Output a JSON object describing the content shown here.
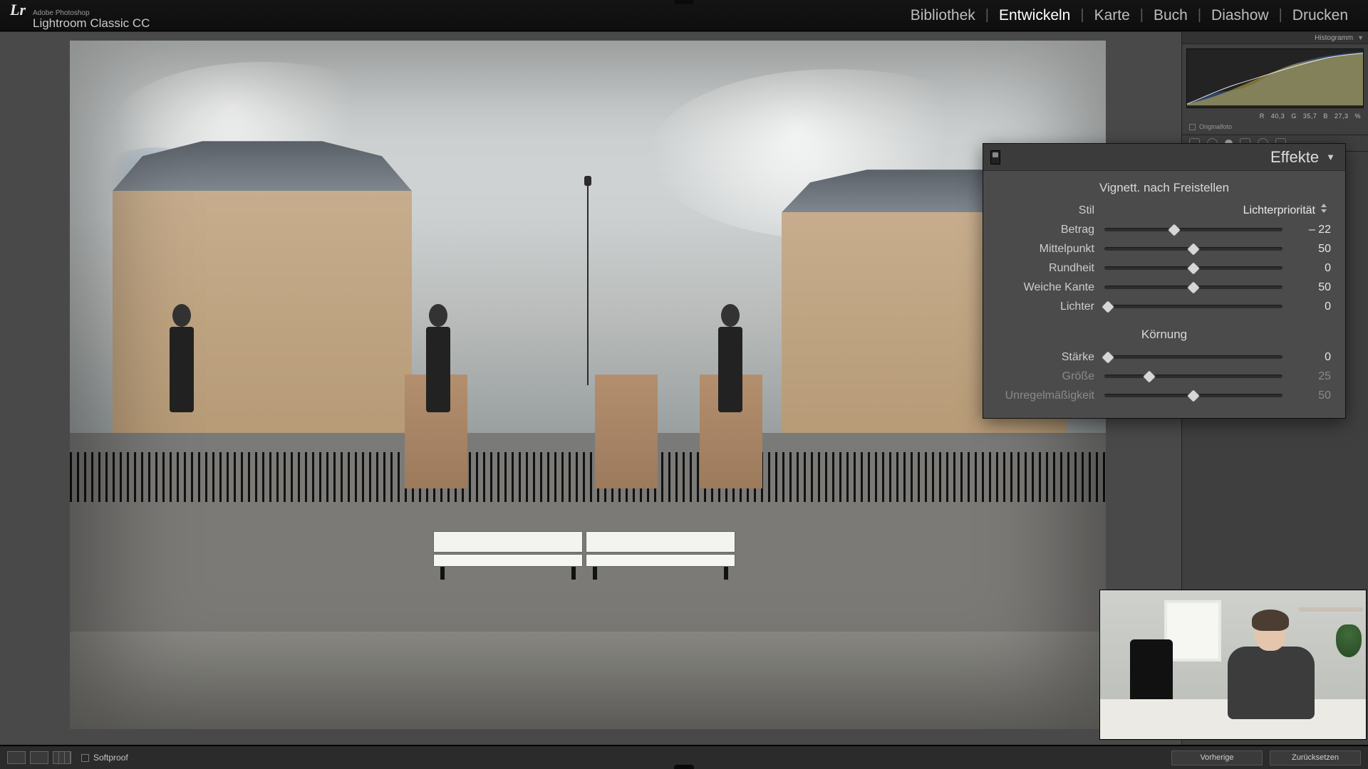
{
  "brand": {
    "sub": "Adobe Photoshop",
    "name": "Lightroom Classic CC",
    "logo": "Lr"
  },
  "modules": {
    "items": [
      "Bibliothek",
      "Entwickeln",
      "Karte",
      "Buch",
      "Diashow",
      "Drucken"
    ],
    "active_index": 1
  },
  "histogram": {
    "title": "Histogramm",
    "readout": {
      "r_label": "R",
      "r": "40,3",
      "g_label": "G",
      "g": "35,7",
      "b_label": "B",
      "b": "27,3",
      "pct": "%"
    },
    "original_checkbox": "Originalfoto"
  },
  "effects_panel": {
    "title": "Effekte",
    "vignette": {
      "section": "Vignett. nach Freistellen",
      "style_label": "Stil",
      "style_value": "Lichterpriorität",
      "sliders": [
        {
          "label": "Betrag",
          "value": "– 22",
          "pos": 39,
          "dim": false
        },
        {
          "label": "Mittelpunkt",
          "value": "50",
          "pos": 50,
          "dim": false
        },
        {
          "label": "Rundheit",
          "value": "0",
          "pos": 50,
          "dim": false
        },
        {
          "label": "Weiche Kante",
          "value": "50",
          "pos": 50,
          "dim": false
        },
        {
          "label": "Lichter",
          "value": "0",
          "pos": 2,
          "dim": false
        }
      ]
    },
    "grain": {
      "section": "Körnung",
      "sliders": [
        {
          "label": "Stärke",
          "value": "0",
          "pos": 2,
          "dim": false
        },
        {
          "label": "Größe",
          "value": "25",
          "pos": 25,
          "dim": true
        },
        {
          "label": "Unregelmäßigkeit",
          "value": "50",
          "pos": 50,
          "dim": true
        }
      ]
    }
  },
  "footer": {
    "softproof": "Softproof",
    "prev": "Vorherige",
    "reset": "Zurücksetzen"
  }
}
